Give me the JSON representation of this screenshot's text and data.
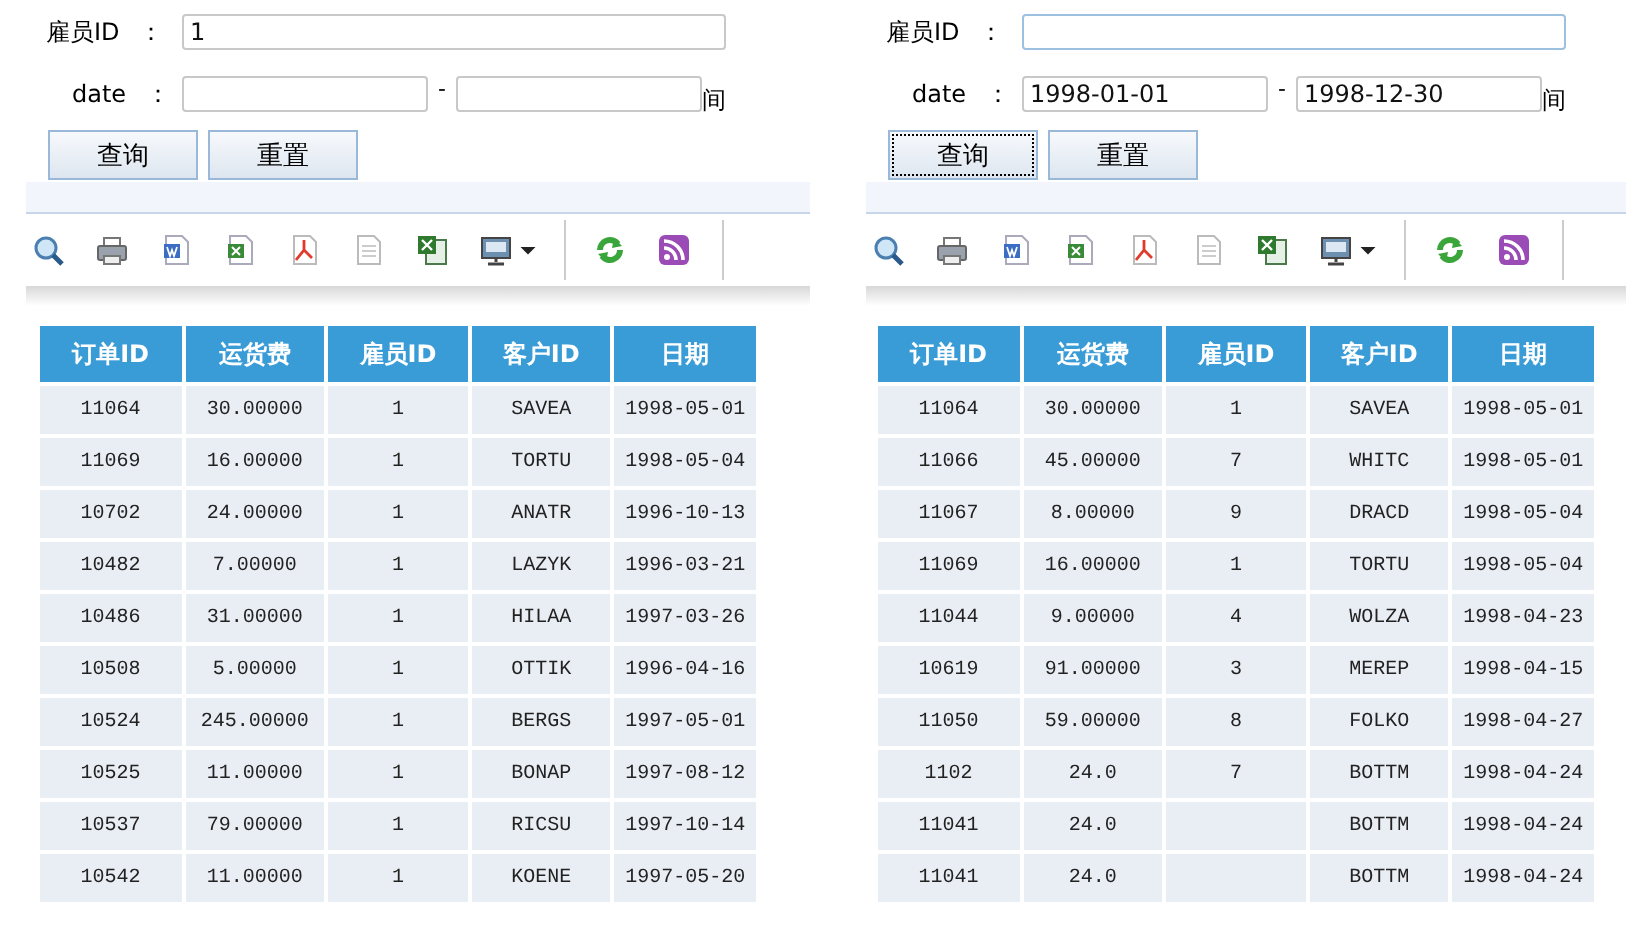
{
  "panels": [
    {
      "employee_field": {
        "label": "雇员ID ：",
        "value": "1",
        "focused": false
      },
      "date_field": {
        "label": "date ：",
        "separator": "-",
        "suffix": "间"
      },
      "buttons": [
        {
          "label": "查询",
          "focused": false
        },
        {
          "label": "重置",
          "focused": false
        }
      ],
      "table": {
        "columns": [
          "订单ID",
          "运货费",
          "雇员ID",
          "客户ID",
          "日期"
        ],
        "rows": [
          [
            "11064",
            "30.00000",
            "1",
            "SAVEA",
            "1998-05-01"
          ],
          [
            "11069",
            "16.00000",
            "1",
            "TORTU",
            "1998-05-04"
          ],
          [
            "10702",
            "24.00000",
            "1",
            "ANATR",
            "1996-10-13"
          ],
          [
            "10482",
            "7.00000",
            "1",
            "LAZYK",
            "1996-03-21"
          ],
          [
            "10486",
            "31.00000",
            "1",
            "HILAA",
            "1997-03-26"
          ],
          [
            "10508",
            "5.00000",
            "1",
            "OTTIK",
            "1996-04-16"
          ],
          [
            "10524",
            "245.00000",
            "1",
            "BERGS",
            "1997-05-01"
          ],
          [
            "10525",
            "11.00000",
            "1",
            "BONAP",
            "1997-08-12"
          ],
          [
            "10537",
            "79.00000",
            "1",
            "RICSU",
            "1997-10-14"
          ],
          [
            "10542",
            "11.00000",
            "1",
            "KOENE",
            "1997-05-20"
          ]
        ]
      }
    },
    {
      "employee_field": {
        "label": "雇员ID ：",
        "focused": true
      },
      "date_field": {
        "label": "date ：",
        "from": "1998-01-01",
        "separator": "-",
        "to": "1998-12-30",
        "suffix": "间"
      },
      "buttons": [
        {
          "label": "查询",
          "focused": true
        },
        {
          "label": "重置",
          "focused": false
        }
      ],
      "table": {
        "columns": [
          "订单ID",
          "运货费",
          "雇员ID",
          "客户ID",
          "日期"
        ],
        "rows": [
          [
            "11064",
            "30.00000",
            "1",
            "SAVEA",
            "1998-05-01"
          ],
          [
            "11066",
            "45.00000",
            "7",
            "WHITC",
            "1998-05-01"
          ],
          [
            "11067",
            "8.00000",
            "9",
            "DRACD",
            "1998-05-04"
          ],
          [
            "11069",
            "16.00000",
            "1",
            "TORTU",
            "1998-05-04"
          ],
          [
            "11044",
            "9.00000",
            "4",
            "WOLZA",
            "1998-04-23"
          ],
          [
            "10619",
            "91.00000",
            "3",
            "MEREP",
            "1998-04-15"
          ],
          [
            "11050",
            "59.00000",
            "8",
            "FOLKO",
            "1998-04-27"
          ],
          [
            "1102",
            "24.0",
            "7",
            "BOTTM",
            "1998-04-24"
          ],
          [
            "11041",
            "24.0",
            null,
            "BOTTM",
            "1998-04-24"
          ],
          [
            "11041",
            "24.0",
            null,
            "BOTTM",
            "1998-04-24"
          ]
        ]
      }
    }
  ]
}
